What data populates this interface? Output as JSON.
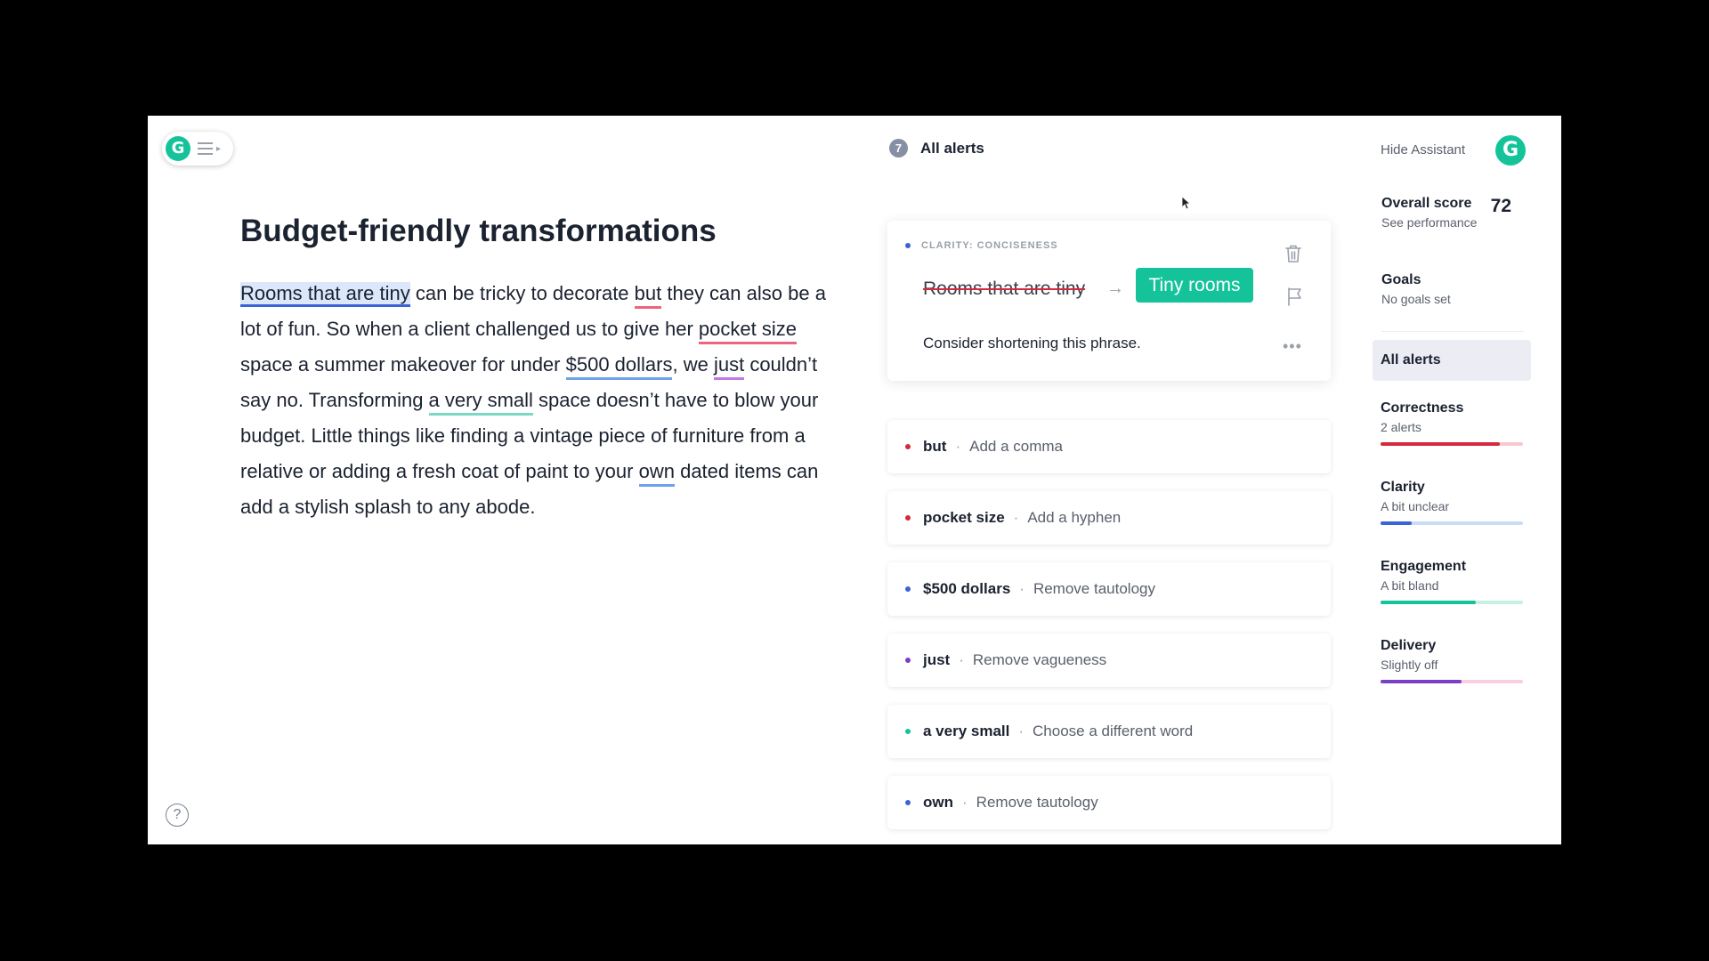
{
  "editor": {
    "title": "Budget-friendly transformations",
    "p1": "Rooms that are tiny",
    "p2": " can be tricky to decorate ",
    "p3": "but",
    "p4": " they can also be a lot of fun.  So when a client challenged us to give her ",
    "p5": "pocket size",
    "p6": " space a summer makeover for under ",
    "p7": "$500 dollars",
    "p8": ", we ",
    "p9": "just",
    "p10": " couldn’t say no. Transforming ",
    "p11": "a very small",
    "p12": " space doesn’t have to blow your budget. Little things like finding a vintage piece of furniture from a relative or adding a fresh coat of paint to your ",
    "p13": "own",
    "p14": " dated items can add a stylish splash to any abode.",
    "help_icon_glyph": "?"
  },
  "alerts": {
    "count": "7",
    "title": "All alerts",
    "main_card": {
      "category": "CLARITY: CONCISENESS",
      "original": "Rooms that are tiny",
      "arrow": "→",
      "replacement": "Tiny rooms",
      "message": "Consider shortening this phrase.",
      "more": "•••",
      "dot_color": "#3a63d8"
    },
    "items": [
      {
        "word": "but",
        "sep": "·",
        "action": "Add a comma",
        "color": "#d42a3b"
      },
      {
        "word": "pocket size",
        "sep": "·",
        "action": "Add a hyphen",
        "color": "#d42a3b"
      },
      {
        "word": "$500 dollars",
        "sep": "·",
        "action": "Remove tautology",
        "color": "#3a63d8"
      },
      {
        "word": "just",
        "sep": "·",
        "action": "Remove vagueness",
        "color": "#7b3fc4"
      },
      {
        "word": "a very small",
        "sep": "·",
        "action": "Choose a different word",
        "color": "#15c39a"
      },
      {
        "word": "own",
        "sep": "·",
        "action": "Remove tautology",
        "color": "#3a63d8"
      }
    ]
  },
  "sidebar": {
    "hide_label": "Hide Assistant",
    "logo_glyph": "G",
    "score_label": "Overall score",
    "score_value": "72",
    "see_performance": "See performance",
    "goals_label": "Goals",
    "goals_sub": "No goals set",
    "all_alerts": "All alerts",
    "categories": [
      {
        "title": "Correctness",
        "sub": "2 alerts",
        "color": "#d42a3b",
        "track": "#f6c9d0",
        "level": 0.84
      },
      {
        "title": "Clarity",
        "sub": "A bit unclear",
        "color": "#3a63d8",
        "track": "#c9dcf6",
        "level": 0.22
      },
      {
        "title": "Engagement",
        "sub": "A bit bland",
        "color": "#15c39a",
        "track": "#c7efe4",
        "level": 0.67
      },
      {
        "title": "Delivery",
        "sub": "Slightly off",
        "color": "#7b3fc4",
        "track": "#f7cfe0",
        "level": 0.57
      }
    ]
  }
}
